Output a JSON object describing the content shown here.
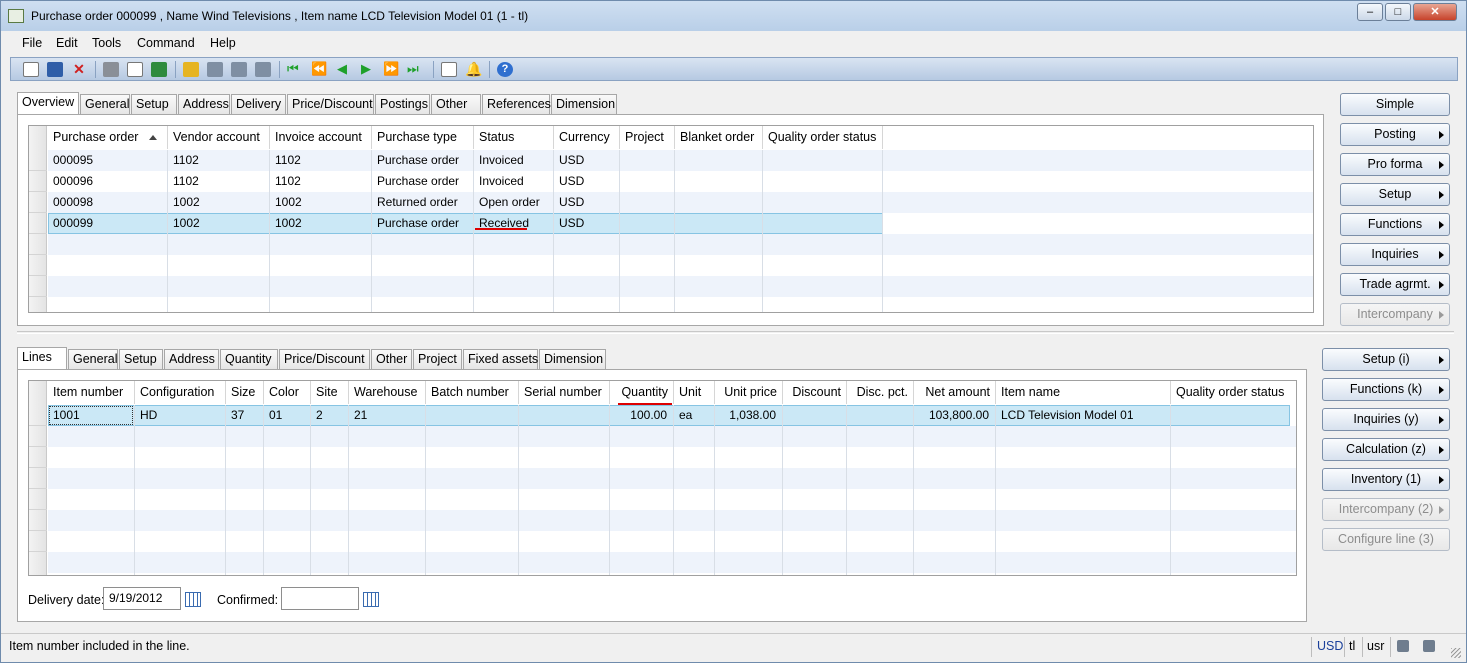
{
  "window": {
    "title": "Purchase order 000099 , Name Wind Televisions , Item name LCD Television Model 01 (1 - tl)"
  },
  "menu": [
    "File",
    "Edit",
    "Tools",
    "Command",
    "Help"
  ],
  "header_tabs": [
    "Overview",
    "General",
    "Setup",
    "Address",
    "Delivery",
    "Price/Discount",
    "Postings",
    "Other",
    "References",
    "Dimension"
  ],
  "header_grid": {
    "columns": [
      "Purchase order",
      "Vendor account",
      "Invoice account",
      "Purchase type",
      "Status",
      "Currency",
      "Project",
      "Blanket order",
      "Quality order status"
    ],
    "rows": [
      [
        "000095",
        "1102",
        "1102",
        "Purchase order",
        "Invoiced",
        "USD",
        "",
        "",
        ""
      ],
      [
        "000096",
        "1102",
        "1102",
        "Purchase order",
        "Invoiced",
        "USD",
        "",
        "",
        ""
      ],
      [
        "000098",
        "1002",
        "1002",
        "Returned order",
        "Open order",
        "USD",
        "",
        "",
        ""
      ],
      [
        "000099",
        "1002",
        "1002",
        "Purchase order",
        "Received",
        "USD",
        "",
        "",
        ""
      ]
    ]
  },
  "header_buttons": [
    {
      "label": "Simple",
      "enabled": true,
      "menu": false
    },
    {
      "label": "Posting",
      "enabled": true,
      "menu": true
    },
    {
      "label": "Pro forma",
      "enabled": true,
      "menu": true
    },
    {
      "label": "Setup",
      "enabled": true,
      "menu": true
    },
    {
      "label": "Functions",
      "enabled": true,
      "menu": true
    },
    {
      "label": "Inquiries",
      "enabled": true,
      "menu": true
    },
    {
      "label": "Trade agrmt.",
      "enabled": true,
      "menu": true
    },
    {
      "label": "Intercompany",
      "enabled": false,
      "menu": true
    }
  ],
  "lines_tabs": [
    "Lines",
    "General",
    "Setup",
    "Address",
    "Quantity",
    "Price/Discount",
    "Other",
    "Project",
    "Fixed assets",
    "Dimension"
  ],
  "lines_grid": {
    "columns": [
      "Item number",
      "Configuration",
      "Size",
      "Color",
      "Site",
      "Warehouse",
      "Batch number",
      "Serial number",
      "Quantity",
      "Unit",
      "Unit price",
      "Discount",
      "Disc. pct.",
      "Net amount",
      "Item name",
      "Quality order status"
    ],
    "rows": [
      [
        "1001",
        "HD",
        "37",
        "01",
        "2",
        "21",
        "",
        "",
        "100.00",
        "ea",
        "1,038.00",
        "",
        "",
        "103,800.00",
        "LCD Television Model 01",
        ""
      ]
    ]
  },
  "lines_buttons": [
    {
      "label": "Setup (i)",
      "enabled": true
    },
    {
      "label": "Functions (k)",
      "enabled": true
    },
    {
      "label": "Inquiries (y)",
      "enabled": true
    },
    {
      "label": "Calculation (z)",
      "enabled": true
    },
    {
      "label": "Inventory (1)",
      "enabled": true
    },
    {
      "label": "Intercompany (2)",
      "enabled": false
    },
    {
      "label": "Configure line (3)",
      "enabled": false
    }
  ],
  "delivery": {
    "date_label": "Delivery date:",
    "date_value": "9/19/2012",
    "confirmed_label": "Confirmed:",
    "confirmed_value": ""
  },
  "status": {
    "message": "Item number included in the line.",
    "currency": "USD",
    "company": "tl",
    "layer": "usr"
  }
}
